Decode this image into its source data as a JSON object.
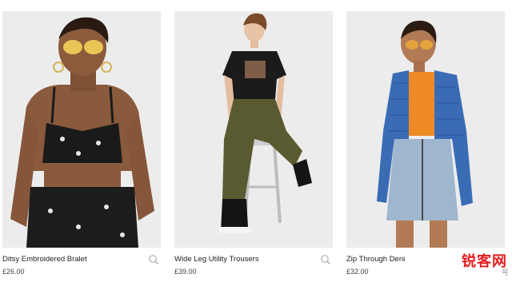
{
  "products": [
    {
      "name": "Ditsy Embroidered Bralet",
      "price": "£26.00"
    },
    {
      "name": "Wide Leg Utility Trousers",
      "price": "£39.00"
    },
    {
      "name": "Zip Through Deni",
      "price": "£32.00"
    }
  ],
  "watermark": {
    "text": "锐客网",
    "sub": "号"
  },
  "icons": {
    "zoom": "magnifier-icon"
  },
  "colors": {
    "background": "#ffffff",
    "photo_bg": "#ececec",
    "watermark": "#e21d1d"
  }
}
